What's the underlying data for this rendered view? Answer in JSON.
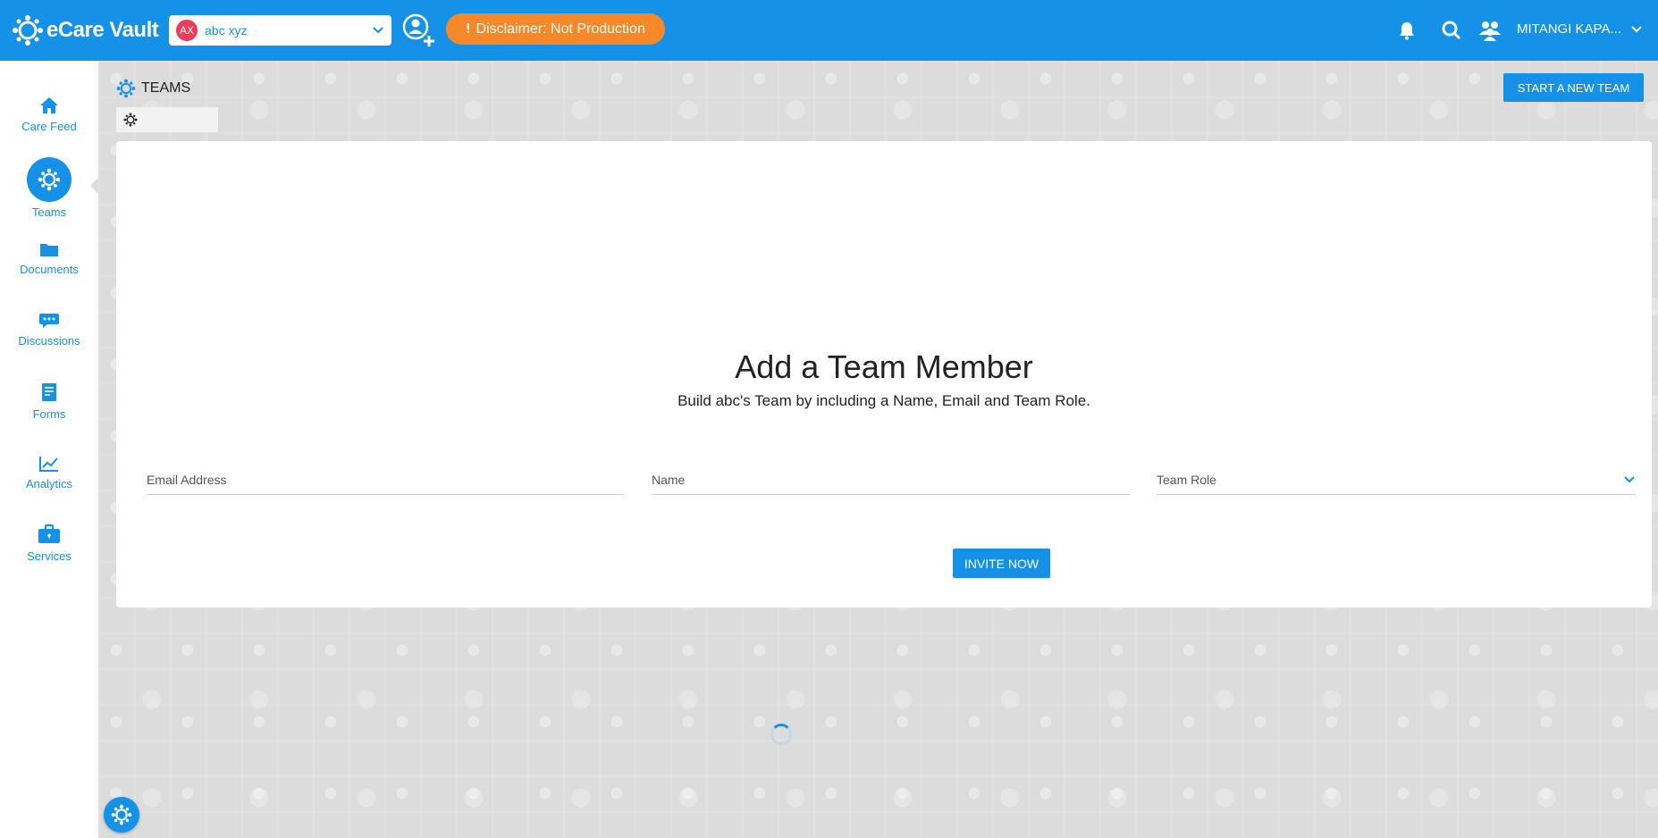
{
  "header": {
    "brand": "eCare Vault",
    "patient": {
      "initials": "AX",
      "name": "abc xyz"
    },
    "disclaimer": "Disclaimer: Not Production",
    "user_name": "MITANGI KAPA..."
  },
  "sidebar": {
    "items": [
      {
        "label": "Care Feed",
        "icon": "home-icon"
      },
      {
        "label": "Teams",
        "icon": "teams-icon",
        "active": true
      },
      {
        "label": "Documents",
        "icon": "folder-icon"
      },
      {
        "label": "Discussions",
        "icon": "chat-icon"
      },
      {
        "label": "Forms",
        "icon": "form-icon"
      },
      {
        "label": "Analytics",
        "icon": "chart-icon"
      },
      {
        "label": "Services",
        "icon": "briefcase-icon"
      }
    ]
  },
  "main": {
    "section_title": "TEAMS",
    "start_team_label": "START A NEW TEAM",
    "card": {
      "title": "Add a Team Member",
      "subtitle": "Build abc's Team by including a Name, Email and Team Role.",
      "email_placeholder": "Email Address",
      "name_placeholder": "Name",
      "role_label": "Team Role",
      "invite_label": "INVITE NOW"
    }
  },
  "colors": {
    "primary": "#1591e8",
    "disclaimer": "#f5892a",
    "avatar": "#ef3b57",
    "background": "#dcdcdc"
  }
}
